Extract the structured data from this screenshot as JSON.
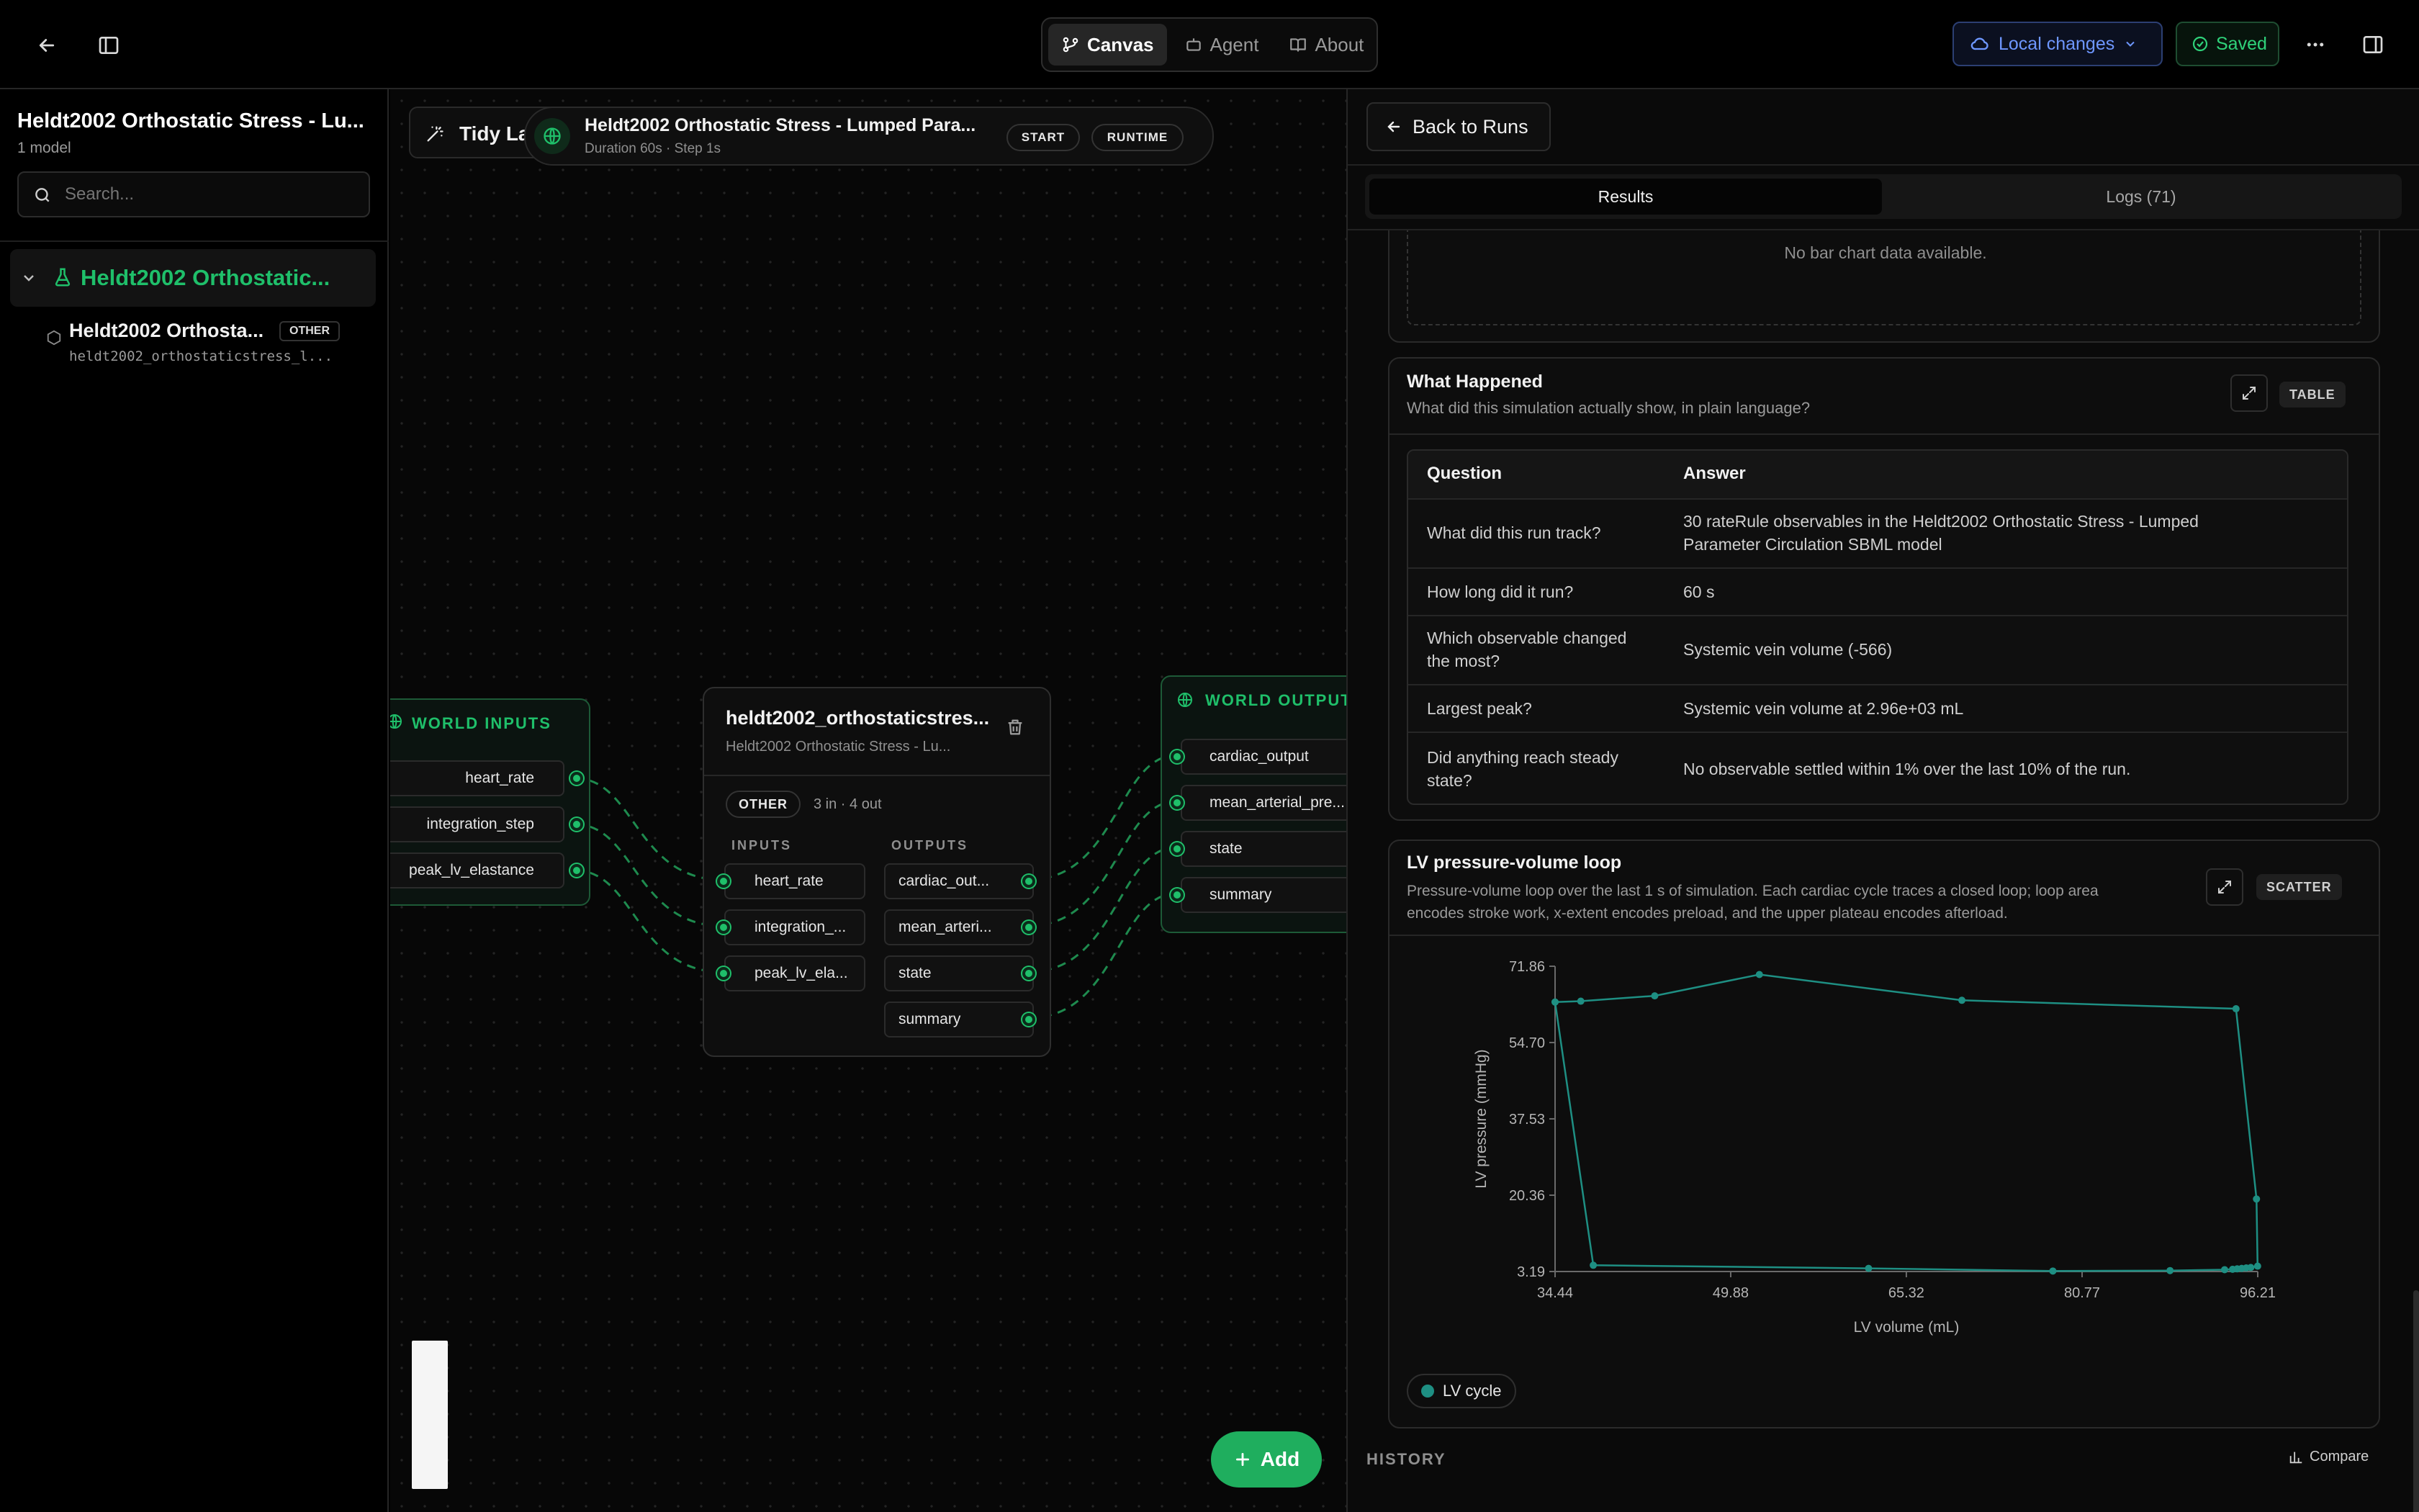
{
  "topbar": {
    "tabs": [
      {
        "label": "Canvas",
        "icon": "git-branch-icon"
      },
      {
        "label": "Agent",
        "icon": "robot-icon"
      },
      {
        "label": "About",
        "icon": "book-icon"
      }
    ],
    "local_changes_label": "Local changes",
    "saved_label": "Saved"
  },
  "sidebar": {
    "project_title": "Heldt2002 Orthostatic Stress - Lu...",
    "model_count": "1 model",
    "search_placeholder": "Search...",
    "group_label": "Heldt2002 Orthostatic...",
    "item_title": "Heldt2002 Orthosta...",
    "item_badge": "OTHER",
    "item_id": "heldt2002_orthostaticstress_l..."
  },
  "canvas": {
    "tidy_label": "Tidy La",
    "run_title": "Heldt2002 Orthostatic Stress - Lumped Para...",
    "run_meta": "Duration 60s · Step 1s",
    "chip_start": "START",
    "chip_runtime": "RUNTIME",
    "world_inputs": {
      "title": "WORLD INPUTS",
      "ports": [
        "heart_rate",
        "integration_step",
        "peak_lv_elastance"
      ]
    },
    "model_node": {
      "title": "heldt2002_orthostaticstres...",
      "subtitle": "Heldt2002 Orthostatic Stress - Lu...",
      "badge": "OTHER",
      "io_count": "3 in · 4 out",
      "inputs_label": "INPUTS",
      "outputs_label": "OUTPUTS",
      "inputs": [
        "heart_rate",
        "integration_...",
        "peak_lv_ela..."
      ],
      "outputs": [
        "cardiac_out...",
        "mean_arteri...",
        "state",
        "summary"
      ]
    },
    "world_outputs": {
      "title": "WORLD OUTPUTS",
      "ports": [
        "cardiac_output",
        "mean_arterial_pre...",
        "state",
        "summary"
      ]
    },
    "add_label": "Add"
  },
  "panel": {
    "back_label": "Back to Runs",
    "tabs": [
      "Results",
      "Logs (71)"
    ],
    "bar_empty_text": "No bar chart data available.",
    "what_happened": {
      "title": "What Happened",
      "subtitle": "What did this simulation actually show, in plain language?",
      "badge": "TABLE",
      "col_question": "Question",
      "col_answer": "Answer",
      "rows": [
        {
          "q1": "What did this run track?",
          "q2": "",
          "a1": "30 rateRule observables in the Heldt2002 Orthostatic Stress - Lumped",
          "a2": "Parameter Circulation SBML model"
        },
        {
          "q1": "How long did it run?",
          "q2": "",
          "a1": "60 s",
          "a2": ""
        },
        {
          "q1": "Which observable changed",
          "q2": "the most?",
          "a1": "Systemic vein volume (-566)",
          "a2": ""
        },
        {
          "q1": "Largest peak?",
          "q2": "",
          "a1": "Systemic vein volume at 2.96e+03 mL",
          "a2": ""
        },
        {
          "q1": "Did anything reach steady",
          "q2": "state?",
          "a1": "No observable settled within 1% over the last 10% of the run.",
          "a2": ""
        }
      ]
    },
    "pv_loop": {
      "title": "LV pressure-volume loop",
      "subtitle_1": "Pressure-volume loop over the last 1 s of simulation. Each cardiac cycle traces a closed loop; loop area",
      "subtitle_2": "encodes stroke work, x-extent encodes preload, and the upper plateau encodes afterload.",
      "badge": "SCATTER",
      "legend_label": "LV cycle"
    },
    "history_label": "HISTORY",
    "compare_label": "Compare"
  },
  "colors": {
    "accent": "#1fbf6a",
    "series": "#1e8f83",
    "link": "#5b8cff"
  },
  "chart_data": {
    "type": "scatter",
    "title": "",
    "xlabel": "LV volume (mL)",
    "ylabel": "LV pressure (mmHg)",
    "xlim": [
      34.44,
      96.21
    ],
    "ylim": [
      3.19,
      71.86
    ],
    "xticks": [
      "34.44",
      "49.88",
      "65.32",
      "80.77",
      "96.21"
    ],
    "yticks": [
      "71.86",
      "54.70",
      "37.53",
      "20.36",
      "3.19"
    ],
    "series": [
      {
        "name": "LV cycle",
        "points": [
          [
            34.44,
            63.8
          ],
          [
            36.7,
            64.0
          ],
          [
            43.2,
            65.2
          ],
          [
            52.4,
            70.0
          ],
          [
            70.2,
            64.2
          ],
          [
            94.3,
            62.3
          ],
          [
            96.1,
            19.5
          ],
          [
            96.2,
            4.4
          ],
          [
            95.6,
            4.1
          ],
          [
            95.2,
            4.0
          ],
          [
            94.8,
            3.9
          ],
          [
            94.4,
            3.8
          ],
          [
            94.0,
            3.7
          ],
          [
            93.3,
            3.6
          ],
          [
            88.5,
            3.4
          ],
          [
            78.2,
            3.3
          ],
          [
            62.0,
            3.9
          ],
          [
            37.8,
            4.6
          ],
          [
            34.44,
            63.8
          ]
        ]
      }
    ]
  }
}
